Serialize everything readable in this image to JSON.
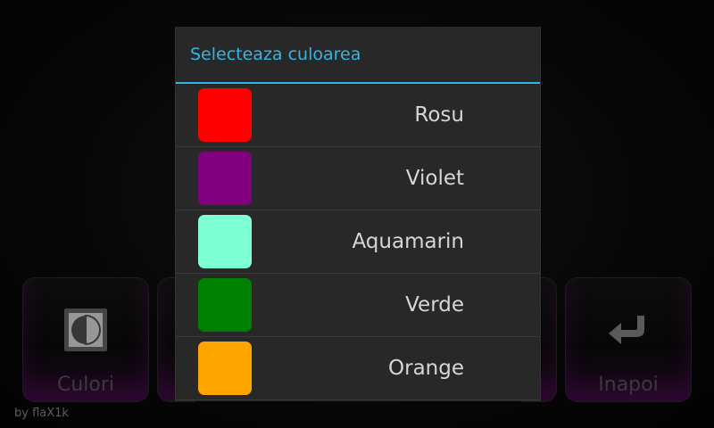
{
  "background": {
    "tiles": [
      {
        "label": "Culori",
        "icon": "contrast-icon"
      },
      {
        "label": "",
        "icon": ""
      },
      {
        "label": "",
        "icon": ""
      },
      {
        "label": "Inapoi",
        "icon": "back-arrow-icon"
      }
    ],
    "credit": "by flaX1k"
  },
  "dialog": {
    "title": "Selecteaza culoarea",
    "accent": "#33b5e5",
    "items": [
      {
        "name": "Rosu",
        "color": "#ff0000"
      },
      {
        "name": "Violet",
        "color": "#800080"
      },
      {
        "name": "Aquamarin",
        "color": "#7fffd4"
      },
      {
        "name": "Verde",
        "color": "#008000"
      },
      {
        "name": "Orange",
        "color": "#ffa500"
      }
    ]
  }
}
